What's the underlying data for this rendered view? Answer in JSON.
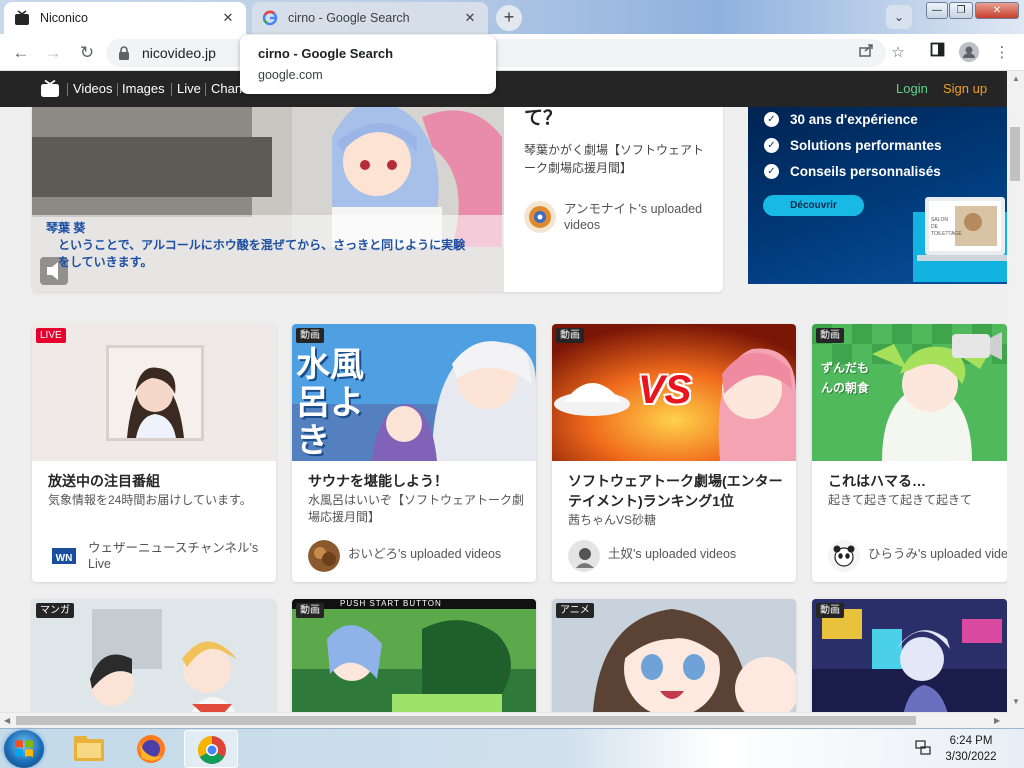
{
  "browser": {
    "tabs": [
      {
        "title": "Niconico",
        "active": true,
        "icon": "niconico-icon"
      },
      {
        "title": "cirno - Google Search",
        "active": false,
        "icon": "google-icon"
      }
    ],
    "new_tab": "+",
    "tab_search": "⌄",
    "window_controls": {
      "minimize": "—",
      "maximize": "❐",
      "close": "✕"
    },
    "url": "nicovideo.jp",
    "hover_card": {
      "title": "cirno - Google Search",
      "url": "google.com"
    }
  },
  "site": {
    "nav": [
      "Videos",
      "Images",
      "Live",
      "Chan"
    ],
    "login": "Login",
    "signup": "Sign up"
  },
  "feature": {
    "title": "て？",
    "description": "琴葉かがく劇場【ソフトウェアトーク劇場応援月間】",
    "uploader": "アンモナイト's uploaded videos",
    "subtitle_name": "琴葉 葵",
    "subtitle_text": "ということで、アルコールにホウ酸を混ぜてから、さっきと同じように実験をしていきます。"
  },
  "ad": {
    "items": [
      "30 ans d'expérience",
      "Solutions performantes",
      "Conseils personnalisés"
    ],
    "cta": "Découvrir",
    "mini_text": "SALON DE TOILETTAGE"
  },
  "cards": [
    {
      "badge": "LIVE",
      "title": "放送中の注目番組",
      "desc": "気象情報を24時間お届けしています。",
      "uploader": "ウェザーニュースチャンネル's Live",
      "avatar_text": "WN"
    },
    {
      "badge": "動画",
      "title": "サウナを堪能しよう！",
      "desc": "水風呂はいいぞ【ソフトウェアトーク劇場応援月間】",
      "uploader": "おいどろ's uploaded videos",
      "thumb_text": "水風呂よき"
    },
    {
      "badge": "動画",
      "title": "ソフトウェアトーク劇場(エンターテイメント)ランキング1位",
      "desc": "茜ちゃんVS砂糖",
      "uploader": "土奴's uploaded videos",
      "thumb_text": "VS"
    },
    {
      "badge": "動画",
      "title": "これはハマる…",
      "desc": "起きて起きて起きて起きて",
      "uploader": "ひらうみ's uploaded videos",
      "thumb_text": "ずんだもんの朝食"
    }
  ],
  "row2_badges": [
    "マンガ",
    "動画",
    "アニメ",
    "動画"
  ],
  "row2_thumb_text": "PUSH START BUTTON",
  "taskbar": {
    "time": "6:24 PM",
    "date": "3/30/2022"
  },
  "colors": {
    "nico_bar": "#252525",
    "login": "#5fd38d",
    "signup": "#f0a020",
    "live_badge": "#e6002d",
    "ad_bg": "#003a7a",
    "ad_cta": "#19b9e6"
  }
}
